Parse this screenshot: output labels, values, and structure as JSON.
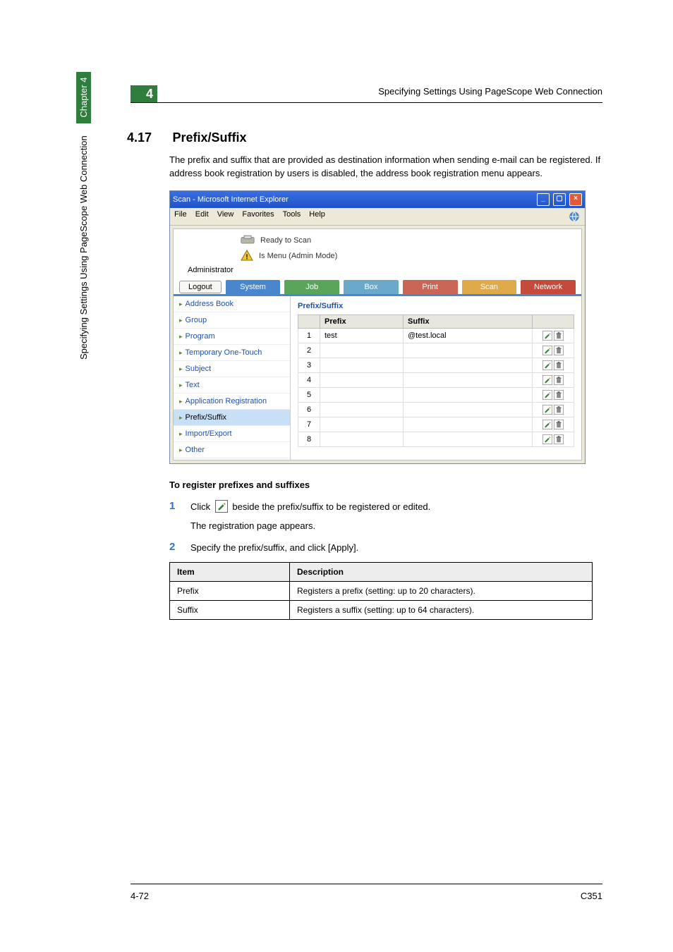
{
  "running_head": "Specifying Settings Using PageScope Web Connection",
  "chapter_badge": "4",
  "section": {
    "num": "4.17",
    "title": "Prefix/Suffix"
  },
  "intro": "The prefix and suffix that are provided as destination information when sending e-mail can be registered. If address book registration by users is disabled, the address book registration menu appears.",
  "screenshot": {
    "window_title": "Scan - Microsoft Internet Explorer",
    "menus": [
      "File",
      "Edit",
      "View",
      "Favorites",
      "Tools",
      "Help"
    ],
    "status_ready": "Ready to Scan",
    "status_mode": "Is Menu (Admin Mode)",
    "admin_label": "Administrator",
    "logout": "Logout",
    "tabs": {
      "system": "System",
      "job": "Job",
      "box": "Box",
      "print": "Print",
      "scan": "Scan",
      "network": "Network"
    },
    "nav": [
      "Address Book",
      "Group",
      "Program",
      "Temporary One-Touch",
      "Subject",
      "Text",
      "Application Registration",
      "Prefix/Suffix",
      "Import/Export",
      "Other"
    ],
    "nav_selected": "Prefix/Suffix",
    "panel_title": "Prefix/Suffix",
    "cols": {
      "prefix": "Prefix",
      "suffix": "Suffix"
    },
    "rows": [
      {
        "n": "1",
        "prefix": "test",
        "suffix": "@test.local"
      },
      {
        "n": "2",
        "prefix": "",
        "suffix": ""
      },
      {
        "n": "3",
        "prefix": "",
        "suffix": ""
      },
      {
        "n": "4",
        "prefix": "",
        "suffix": ""
      },
      {
        "n": "5",
        "prefix": "",
        "suffix": ""
      },
      {
        "n": "6",
        "prefix": "",
        "suffix": ""
      },
      {
        "n": "7",
        "prefix": "",
        "suffix": ""
      },
      {
        "n": "8",
        "prefix": "",
        "suffix": ""
      }
    ]
  },
  "subhead": "To register prefixes and suffixes",
  "step1_a": "Click ",
  "step1_b": " beside the prefix/suffix to be registered or edited.",
  "step1_sub": "The registration page appears.",
  "step2": "Specify the prefix/suffix, and click [Apply].",
  "desc_table": {
    "head_item": "Item",
    "head_desc": "Description",
    "rows": [
      {
        "item": "Prefix",
        "desc": "Registers a prefix (setting: up to 20 characters)."
      },
      {
        "item": "Suffix",
        "desc": "Registers a suffix (setting: up to 64 characters)."
      }
    ]
  },
  "sidebar": {
    "line": "Specifying Settings Using PageScope Web Connection",
    "chapter": "Chapter 4"
  },
  "footer": {
    "left": "4-72",
    "right": "C351"
  }
}
